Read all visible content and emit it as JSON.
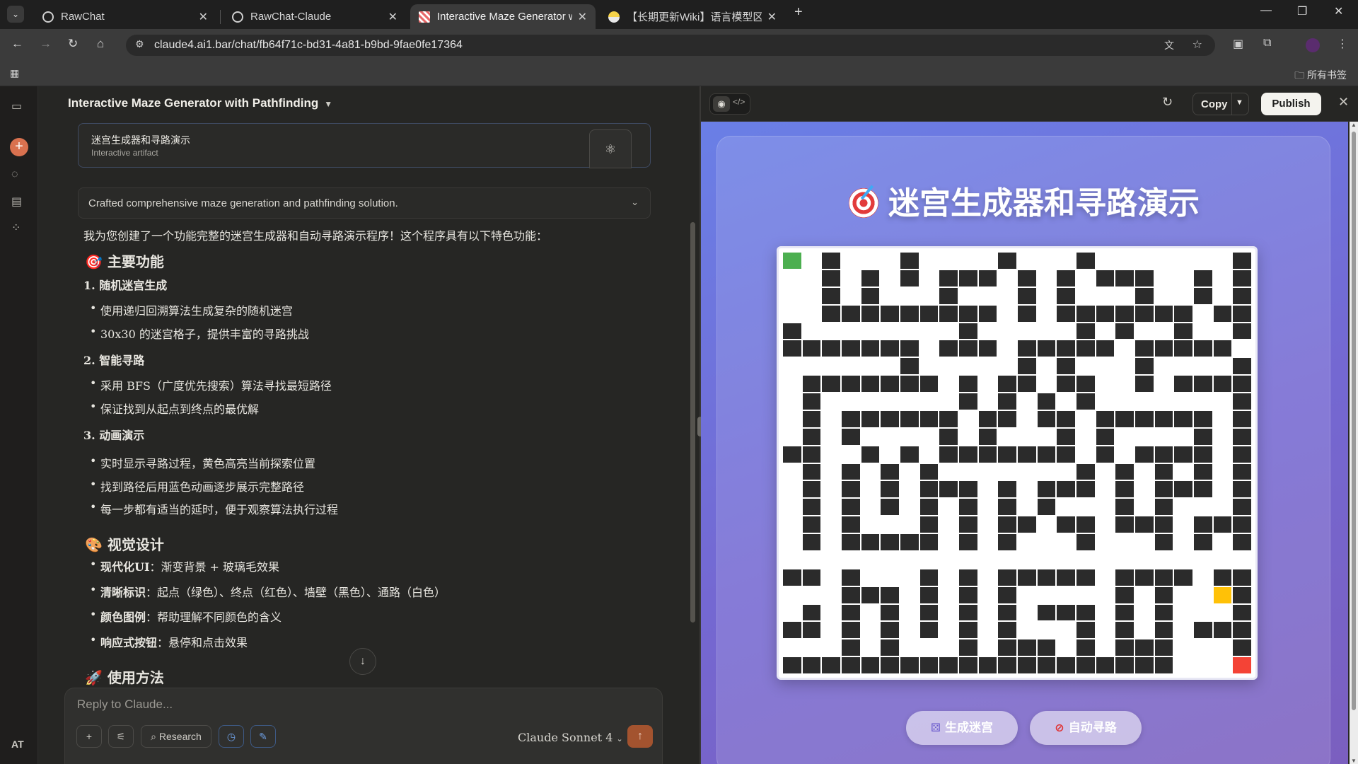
{
  "browser": {
    "tabs": [
      {
        "title": "RawChat"
      },
      {
        "title": "RawChat-Claude"
      },
      {
        "title": "Interactive Maze Generator w"
      },
      {
        "title": "【长期更新Wiki】语言模型区分"
      }
    ],
    "url": "claude4.ai1.bar/chat/fb64f71c-bd31-4a81-b9bd-9fae0fe17364",
    "all_bookmarks": "所有书签"
  },
  "sidebar": {
    "user_initials": "AT"
  },
  "chat": {
    "title": "Interactive Maze Generator with Pathfinding",
    "artifact": {
      "title": "迷宫生成器和寻路演示",
      "subtitle": "Interactive artifact"
    },
    "thinking": "Crafted comprehensive maze generation and pathfinding solution.",
    "intro": "我为您创建了一个功能完整的迷宫生成器和自动寻路演示程序！这个程序具有以下特色功能：",
    "h_features": "🎯 主要功能",
    "s1": "1. 随机迷宫生成",
    "s1_items": [
      "使用递归回溯算法生成复杂的随机迷宫",
      "30x30 的迷宫格子，提供丰富的寻路挑战"
    ],
    "s2": "2. 智能寻路",
    "s2_items": [
      "采用 BFS（广度优先搜索）算法寻找最短路径",
      "保证找到从起点到终点的最优解"
    ],
    "s3": "3. 动画演示",
    "s3_items": [
      "实时显示寻路过程，黄色高亮当前探索位置",
      "找到路径后用蓝色动画逐步展示完整路径",
      "每一步都有适当的延时，便于观察算法执行过程"
    ],
    "h_visual": "🎨 视觉设计",
    "visual_items": [
      {
        "label": "现代化UI",
        "text": "：渐变背景 + 玻璃毛效果"
      },
      {
        "label": "清晰标识",
        "text": "：起点（绿色）、终点（红色）、墙壁（黑色）、通路（白色）"
      },
      {
        "label": "颜色图例",
        "text": "：帮助理解不同颜色的含义"
      },
      {
        "label": "响应式按钮",
        "text": "：悬停和点击效果"
      }
    ],
    "h_usage": "🚀 使用方法",
    "composer": {
      "placeholder": "Reply to Claude...",
      "research": "Research",
      "model": "Claude Sonnet 4"
    }
  },
  "artifact_panel": {
    "copy": "Copy",
    "publish": "Publish",
    "demo_title": "迷宫生成器和寻路演示",
    "generate_btn": "生成迷宫",
    "solve_btn": "自动寻路",
    "colors": {
      "wall": "#2b2b2b",
      "path": "#ffffff",
      "start": "#4caf50",
      "end": "#f44336",
      "current": "#ffc107"
    },
    "maze_grid": [
      "S.#...#....#...#.......#",
      "..#.#.#.###.#.#.###..#.#",
      "..#.#...#...#.#...#..#.#",
      "..#########.#.#######.##",
      "#........#.....#.#..#..#",
      "#######.###.#####.#####.",
      "......#.....#.#...#....#",
      ".#######.#.##.##..#.####",
      ".#.......#.#.#.#.......#",
      ".#.######.##.##.######.#",
      ".#.#....#.#...#.#....#.#",
      "##..#.#.#######.#.####.#",
      ".#.#.#.#.......#.#.#.#.#",
      ".#.#.#.###.#.###.#.###.#",
      ".#.#.#.#.#.#.#...#.#...#",
      ".#.#...#.#.##.##.###.###",
      ".#.#####.#.#...#...#.#.#",
      "........................",
      "##.#...#.#.#####.####.##",
      "...###.#.#.#.....#.#..C#",
      ".#.#.#.#.#.#.###.#.#...#",
      "##.#.#.#.#.#...#.#.#.###",
      "...#.#...#.###.#.###...#",
      "####################...E"
    ]
  }
}
